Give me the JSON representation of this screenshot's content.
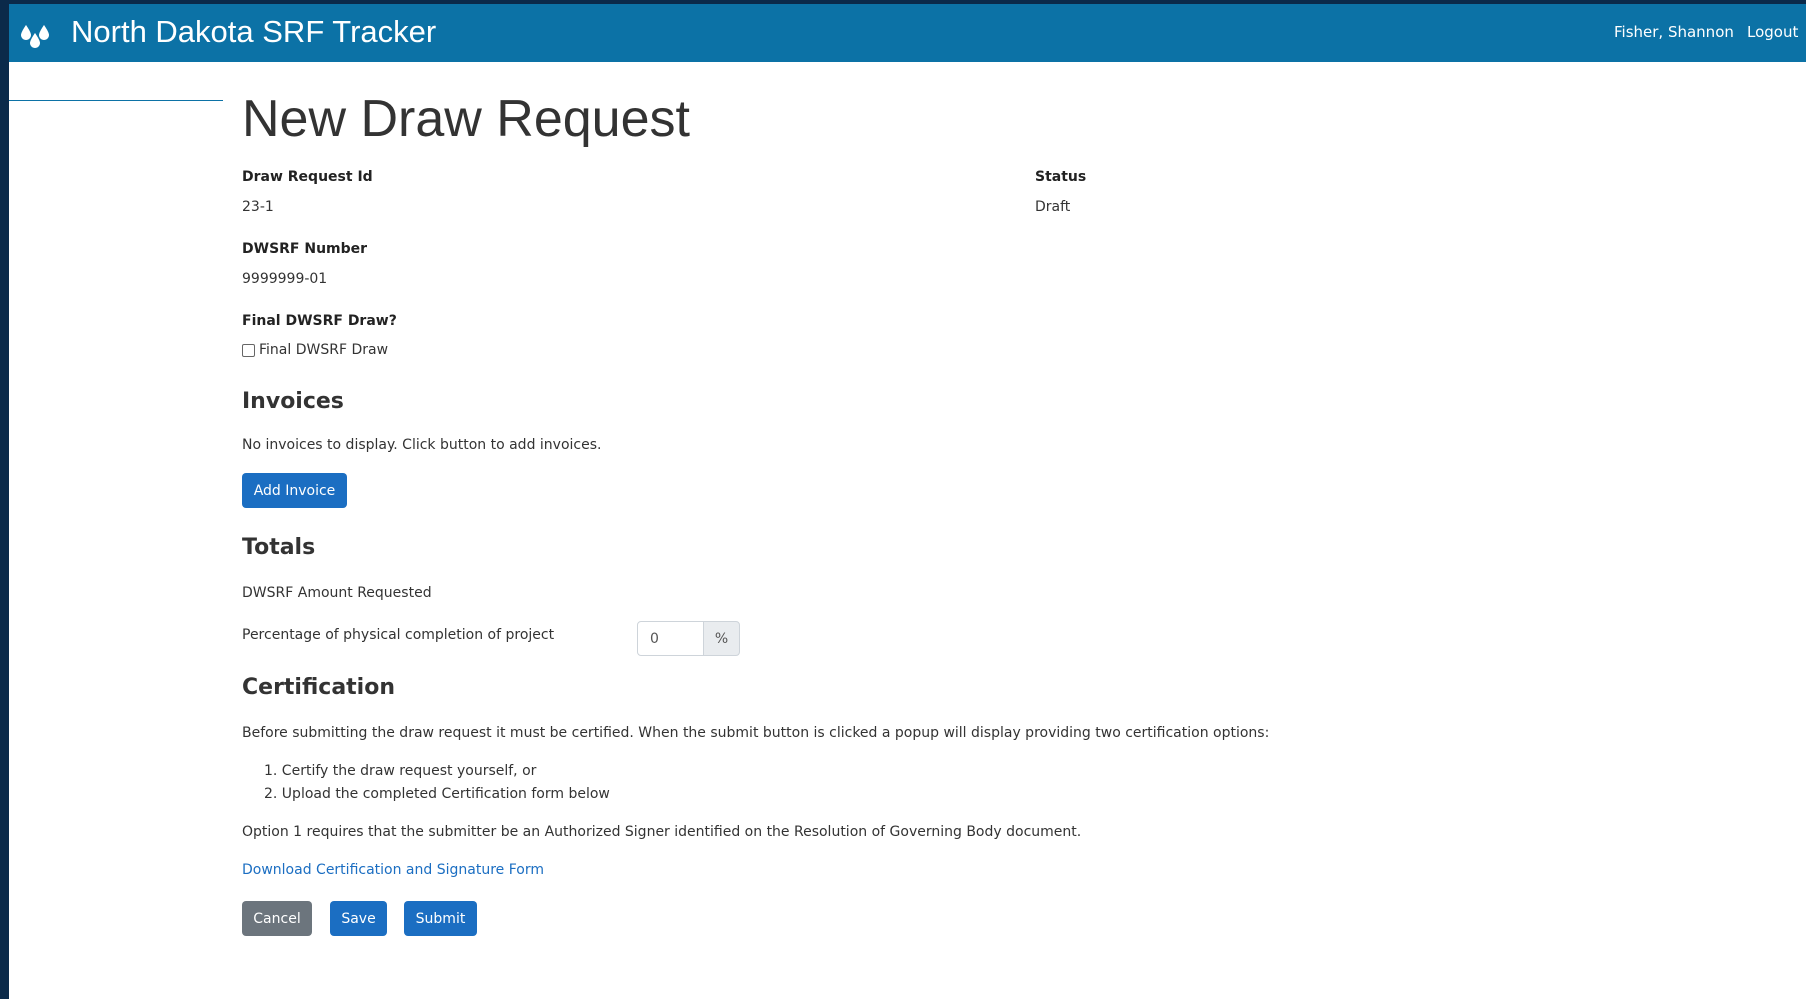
{
  "header": {
    "app_title": "North Dakota SRF Tracker",
    "user_name": "Fisher, Shannon",
    "logout_label": "Logout",
    "brand_icon": "water-drops-icon",
    "bar_color": "#0c72a6"
  },
  "page": {
    "title": "New Draw Request"
  },
  "details": {
    "draw_request_id_label": "Draw Request Id",
    "draw_request_id_value": "23-1",
    "status_label": "Status",
    "status_value": "Draft",
    "dwsrf_number_label": "DWSRF Number",
    "dwsrf_number_value": "9999999-01",
    "final_draw_label": "Final DWSRF Draw?",
    "final_draw_checkbox_label": "Final DWSRF Draw",
    "final_draw_checked": false
  },
  "invoices": {
    "heading": "Invoices",
    "empty_message": "No invoices to display. Click button to add invoices.",
    "add_button_label": "Add Invoice"
  },
  "totals": {
    "heading": "Totals",
    "amount_requested_label": "DWSRF Amount Requested",
    "completion_label": "Percentage of physical completion of project",
    "completion_value": "0",
    "completion_unit": "%"
  },
  "certification": {
    "heading": "Certification",
    "intro": "Before submitting the draw request it must be certified. When the submit button is clicked a popup will display providing two certification options:",
    "options": [
      "1. Certify the draw request yourself, or",
      "2. Upload the completed Certification form below"
    ],
    "note": "Option 1 requires that the submitter be an Authorized Signer identified on the Resolution of Governing Body document.",
    "download_link": "Download Certification and Signature Form"
  },
  "actions": {
    "cancel_label": "Cancel",
    "save_label": "Save",
    "submit_label": "Submit",
    "primary_color": "#1b6ec2",
    "secondary_color": "#6c757d"
  }
}
